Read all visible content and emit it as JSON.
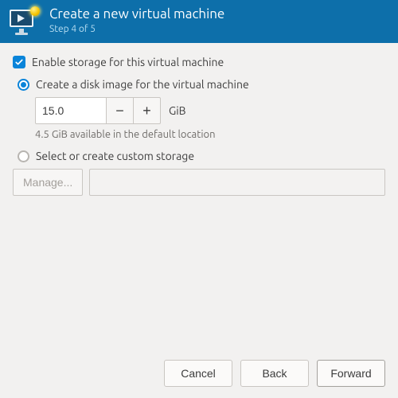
{
  "header": {
    "title": "Create a new virtual machine",
    "step_label": "Step 4 of 5"
  },
  "storage": {
    "enable_label": "Enable storage for this virtual machine",
    "enabled": true,
    "create_image": {
      "label": "Create a disk image for the virtual machine",
      "selected": true,
      "size_value": "15.0",
      "unit": "GiB",
      "available_hint": "4.5 GiB available in the default location"
    },
    "custom": {
      "label": "Select or create custom storage",
      "selected": false,
      "manage_button": "Manage...",
      "path_value": ""
    }
  },
  "footer": {
    "cancel": "Cancel",
    "back": "Back",
    "forward": "Forward"
  }
}
